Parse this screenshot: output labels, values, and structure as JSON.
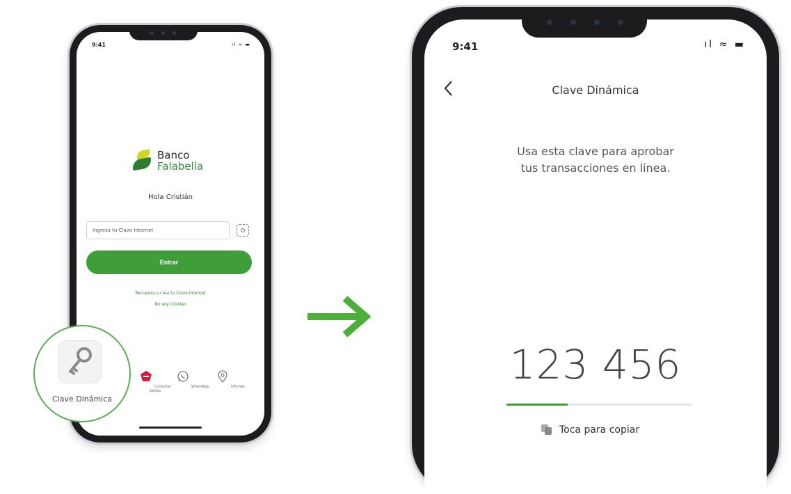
{
  "left_phone": {
    "status_time": "9:41",
    "status_icons": "ıl ≈ ▬",
    "logo": {
      "line1": "Banco",
      "line2": "Falabella"
    },
    "greeting": "Hola Cristián",
    "password_placeholder": "Ingresa tu Clave Internet",
    "enter_button": "Entrar",
    "link_recover": "Recupera o crea tu Clave Internet",
    "link_not_user": "No soy Cristián",
    "bottom_items": [
      {
        "label": "Clave Dinámica",
        "icon": "key-icon"
      },
      {
        "label": "Consultar Saldos",
        "icon": "cmr-icon"
      },
      {
        "label": "WhatsApp",
        "icon": "whatsapp-icon"
      },
      {
        "label": "Oficinas",
        "icon": "location-pin-icon"
      }
    ]
  },
  "right_phone": {
    "status_time": "9:41",
    "status_icons": "ıl ≈ ▬",
    "back_icon": "chevron-left-icon",
    "title": "Clave Dinámica",
    "description_line1": "Usa esta clave para aprobar",
    "description_line2": "tus transacciones en línea.",
    "code": "123 456",
    "timer_progress": 0.33,
    "copy_label": "Toca para copiar"
  },
  "colors": {
    "accent": "#3f9e3a",
    "brand_green": "#2e7d32",
    "brand_yellow": "#cfd61f",
    "cmr_red": "#d7193f"
  }
}
